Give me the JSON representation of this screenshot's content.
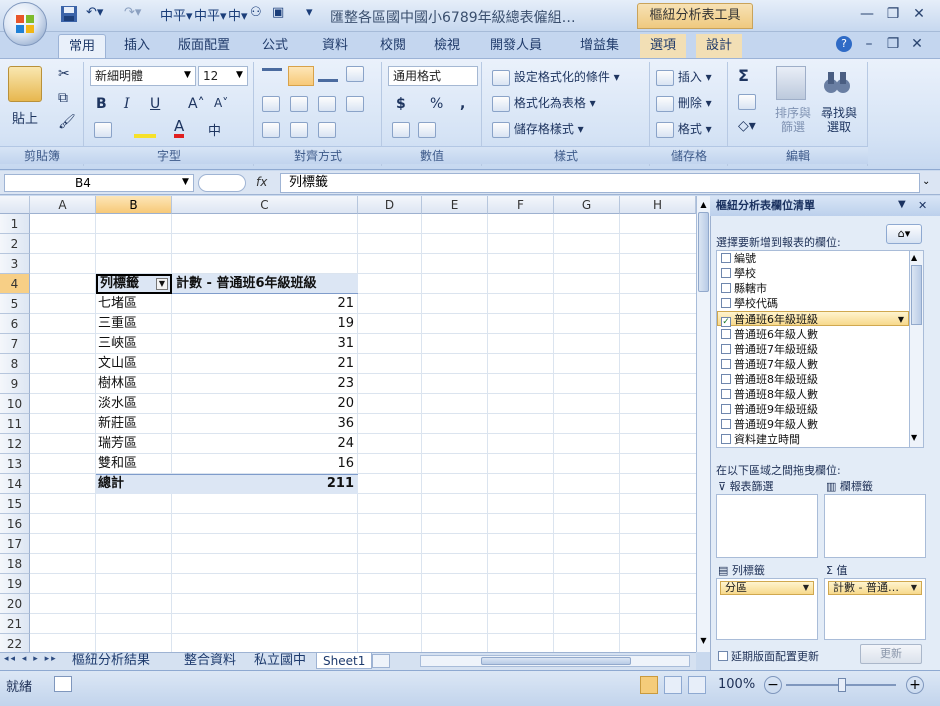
{
  "title_bar": {
    "doc_title": "匯整各區國中國小6789年級總表僱組…",
    "contextual_title": "樞紐分析表工具"
  },
  "ribbon_tabs": [
    "常用",
    "插入",
    "版面配置",
    "公式",
    "資料",
    "校閱",
    "檢視",
    "開發人員",
    "增益集",
    "選項",
    "設計"
  ],
  "ribbon": {
    "clipboard": {
      "paste": "貼上",
      "label": "剪貼簿"
    },
    "font": {
      "name": "新細明體",
      "size": "12",
      "label": "字型",
      "bold": "B",
      "italic": "I",
      "underline": "U",
      "grow": "A˄",
      "shrink": "A˅"
    },
    "alignment": {
      "label": "對齊方式"
    },
    "number": {
      "format": "通用格式",
      "currency": "$",
      "percent": "%",
      "comma": ",",
      "label": "數值"
    },
    "styles": {
      "conditional": "設定格式化的條件",
      "table": "格式化為表格",
      "cell": "儲存格樣式",
      "label": "樣式"
    },
    "cells": {
      "insert": "插入",
      "delete": "刪除",
      "format": "格式",
      "label": "儲存格"
    },
    "editing": {
      "sum": "Σ",
      "sort": "排序與篩選",
      "find": "尋找與選取",
      "label": "編輯"
    }
  },
  "formula_bar": {
    "name_box": "B4",
    "fx": "fx",
    "content": "列標籤"
  },
  "columns": [
    "A",
    "B",
    "C",
    "D",
    "E",
    "F",
    "G",
    "H"
  ],
  "rows": [
    "1",
    "2",
    "3",
    "4",
    "5",
    "6",
    "7",
    "8",
    "9",
    "10",
    "11",
    "12",
    "13",
    "14",
    "15",
    "16",
    "17",
    "18",
    "19",
    "20",
    "21",
    "22"
  ],
  "pivot": {
    "header_label": "列標籤",
    "header_value": "計數 - 普通班6年級班級",
    "items": [
      {
        "label": "七堵區",
        "value": "21"
      },
      {
        "label": "三重區",
        "value": "19"
      },
      {
        "label": "三峽區",
        "value": "31"
      },
      {
        "label": "文山區",
        "value": "21"
      },
      {
        "label": "樹林區",
        "value": "23"
      },
      {
        "label": "淡水區",
        "value": "20"
      },
      {
        "label": "新莊區",
        "value": "36"
      },
      {
        "label": "瑞芳區",
        "value": "24"
      },
      {
        "label": "雙和區",
        "value": "16"
      }
    ],
    "total_label": "總計",
    "total_value": "211"
  },
  "sheet_tabs": [
    "樞紐分析結果",
    "整合資料",
    "私立國中",
    "Sheet1"
  ],
  "status": {
    "mode": "就緒",
    "zoom": "100%"
  },
  "field_pane": {
    "title": "樞紐分析表欄位清單",
    "choose_label": "選擇要新增到報表的欄位:",
    "fields": [
      {
        "name": "編號",
        "checked": false
      },
      {
        "name": "學校",
        "checked": false
      },
      {
        "name": "縣轄市",
        "checked": false
      },
      {
        "name": "學校代碼",
        "checked": false
      },
      {
        "name": "普通班6年級班級",
        "checked": true
      },
      {
        "name": "普通班6年級人數",
        "checked": false
      },
      {
        "name": "普通班7年級班級",
        "checked": false
      },
      {
        "name": "普通班7年級人數",
        "checked": false
      },
      {
        "name": "普通班8年級班級",
        "checked": false
      },
      {
        "name": "普通班8年級人數",
        "checked": false
      },
      {
        "name": "普通班9年級班級",
        "checked": false
      },
      {
        "name": "普通班9年級人數",
        "checked": false
      },
      {
        "name": "資料建立時間",
        "checked": false
      }
    ],
    "drag_label": "在以下區域之間拖曳欄位:",
    "report_filter": "報表篩選",
    "column_labels": "欄標籤",
    "row_labels": "列標籤",
    "values": "值",
    "row_chip": "分區",
    "value_chip": "計數 - 普通…",
    "defer": "延期版面配置更新",
    "update": "更新"
  }
}
